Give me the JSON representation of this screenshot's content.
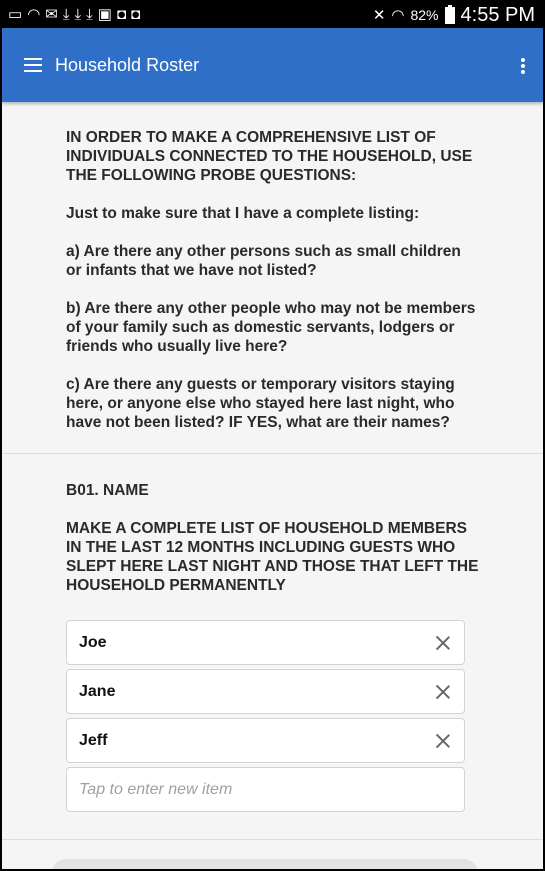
{
  "status_bar": {
    "battery": "82%",
    "time": "4:55 PM"
  },
  "app_bar": {
    "title": "Household Roster"
  },
  "probe": {
    "heading": "IN ORDER TO MAKE A COMPREHENSIVE LIST OF INDIVIDUALS CONNECTED TO THE HOUSEHOLD, USE THE FOLLOWING PROBE QUESTIONS:",
    "intro": "Just to make sure that I have a complete listing:",
    "question_a": "a) Are there any other persons such as small children or infants that we have not listed?",
    "question_b": "b) Are there any other people who may not be members of your family such as domestic servants, lodgers or friends who usually live here?",
    "question_c": "c) Are there any guests or temporary visitors staying here, or anyone else who stayed here last night, who have not been listed? IF YES, what are their names?"
  },
  "b01": {
    "title": "B01. NAME",
    "instruction": "MAKE A COMPLETE LIST OF HOUSEHOLD MEMBERS IN THE LAST 12 MONTHS INCLUDING GUESTS WHO SLEPT HERE LAST NIGHT AND THOSE THAT LEFT THE HOUSEHOLD PERMANENTLY",
    "items": [
      "Joe",
      "Jane",
      "Jeff"
    ],
    "new_item_placeholder": "Tap to enter new item"
  },
  "colors": {
    "app_bar": "#2f6fc7",
    "status_bar": "#000000",
    "background": "#f5f5f5"
  }
}
